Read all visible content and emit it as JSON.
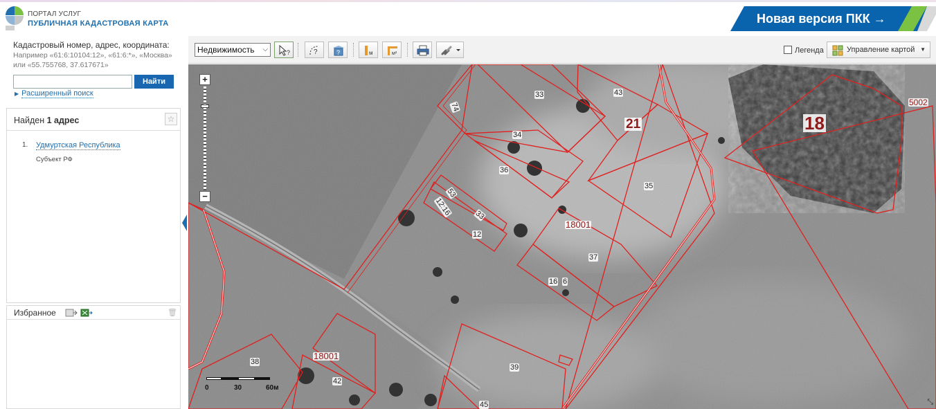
{
  "header": {
    "logo_line1": "ПОРТАЛ УСЛУГ",
    "logo_line2": "ПУБЛИЧНАЯ КАДАСТРОВАЯ КАРТА",
    "banner": "Новая версия ПКК →",
    "banner_colors": {
      "blue": "#0a63ad",
      "green": "#7cc242"
    }
  },
  "search": {
    "title": "Кадастровый номер, адрес, координата:",
    "hint": "Например «61:6:10104:12», «61:6:*», «Москва» или «55.755768, 37.617671»",
    "input_value": "",
    "button": "Найти",
    "advanced_link": "Расширенный поиск"
  },
  "results": {
    "title_prefix": "Найден ",
    "title_count": "1 адрес",
    "items": [
      {
        "num": "1.",
        "name": "Удмуртская Республика",
        "type": "Субъект РФ"
      }
    ]
  },
  "favorites": {
    "title": "Избранное"
  },
  "toolbar": {
    "layer_select": "Недвижимость",
    "legend_label": "Легенда",
    "map_control_label": "Управление картой"
  },
  "map": {
    "parcel_line_color": "#e0201e",
    "scale": {
      "labels": [
        "0",
        "30",
        "60м"
      ]
    },
    "parcel_labels": [
      "33",
      "43",
      "74",
      "34",
      "21",
      "36",
      "35",
      "53",
      "12:16",
      "33",
      "12",
      "18001",
      "37",
      "16",
      "6",
      "38",
      "18001",
      "42",
      "39",
      "45",
      "5002"
    ],
    "quarter_labels": [
      "21",
      "18"
    ]
  }
}
